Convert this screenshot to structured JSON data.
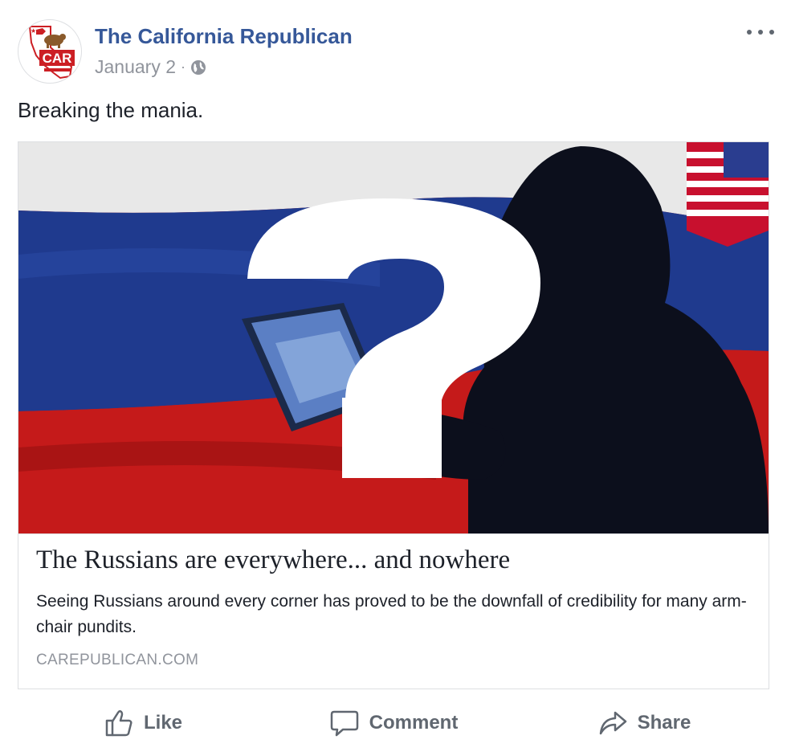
{
  "post": {
    "page_name": "The California Republican",
    "date": "January 2",
    "separator": "·",
    "privacy_icon": "globe-icon",
    "more_icon": "ellipsis-icon",
    "text": "Breaking the mania."
  },
  "avatar": {
    "logo_text": "CAR",
    "logo_colors": {
      "red": "#cc1f24",
      "brown": "#8a5a2b"
    }
  },
  "link": {
    "title": "The Russians are everywhere... and nowhere",
    "description": "Seeing Russians around every corner has proved to be the downfall of credibility for many arm-chair pundits.",
    "domain": "CAREPUBLICAN.COM",
    "image_icon": "question-mark-icon",
    "image_colors": {
      "white": "#e8e8e8",
      "blue": "#1f3a8e",
      "red": "#c51a1a",
      "silhouette": "#0c0f1c"
    }
  },
  "actions": [
    {
      "label": "Like",
      "icon": "thumbs-up-icon"
    },
    {
      "label": "Comment",
      "icon": "speech-bubble-icon"
    },
    {
      "label": "Share",
      "icon": "share-arrow-icon"
    }
  ],
  "colors": {
    "link_blue": "#365899",
    "meta_gray": "#90949c",
    "action_gray": "#606770",
    "border": "#dddfe2"
  }
}
